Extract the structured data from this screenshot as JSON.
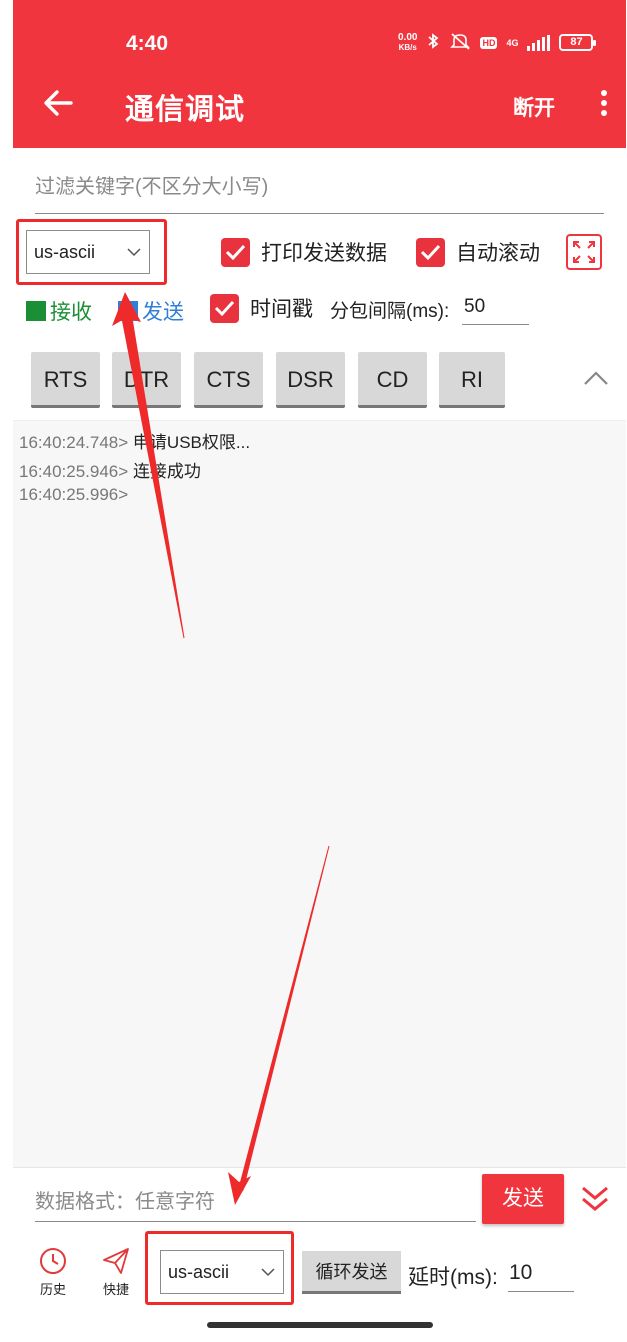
{
  "status": {
    "time": "4:40",
    "net_speed_value": "0.00",
    "net_speed_unit": "KB/s",
    "hd": "HD",
    "network": "4G",
    "battery": "87"
  },
  "appbar": {
    "title": "通信调试",
    "disconnect_label": "断开"
  },
  "filter": {
    "placeholder": "过滤关键字(不区分大小写)"
  },
  "options": {
    "charset_top": "us-ascii",
    "print_sent_label": "打印发送数据",
    "auto_scroll_label": "自动滚动",
    "receive_label": "接收",
    "send_label": "发送",
    "timestamp_label": "时间戳",
    "packet_interval_label": "分包间隔(ms):",
    "packet_interval_value": "50"
  },
  "colors": {
    "accent": "#f0353f",
    "receive": "#1a8f35",
    "send": "#2f7fd8",
    "annotation": "#ee2a2a"
  },
  "signals": [
    "RTS",
    "DTR",
    "CTS",
    "DSR",
    "CD",
    "RI"
  ],
  "log": [
    {
      "ts": "16:40:24.748>",
      "msg": "申请USB权限..."
    },
    {
      "ts": "16:40:25.946>",
      "msg": "连接成功"
    },
    {
      "ts": "16:40:25.996>",
      "msg": ""
    }
  ],
  "send_area": {
    "input_placeholder": "数据格式：任意字符",
    "send_button": "发送",
    "history_label": "历史",
    "quick_label": "快捷",
    "charset_bottom": "us-ascii",
    "loop_send_label": "循环发送",
    "delay_label": "延时(ms):",
    "delay_value": "10"
  },
  "icons": {
    "back": "arrow-left-icon",
    "more": "more-vert-icon",
    "expand": "fullscreen-icon",
    "collapse": "chevron-up-icon",
    "double_chevron": "double-chevron-down-icon",
    "history": "clock-icon",
    "quick": "paper-plane-icon",
    "dropdown": "chevron-down-icon"
  }
}
